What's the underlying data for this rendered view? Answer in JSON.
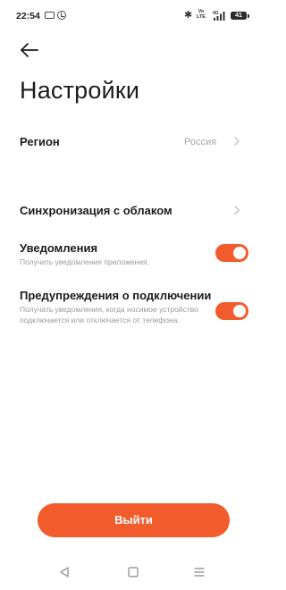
{
  "status_bar": {
    "time": "22:54",
    "bluetooth": "✱",
    "volte_line1": "Vo",
    "volte_line2": "LTE",
    "network": "4G",
    "battery": "41",
    "icons": [
      "mail-icon",
      "alarm-icon",
      "bluetooth-icon",
      "volte-icon",
      "signal-icon",
      "battery-icon"
    ]
  },
  "header": {
    "back_icon": "arrow-left-icon",
    "title": "Настройки"
  },
  "settings": {
    "region": {
      "label": "Регион",
      "value": "Россия"
    },
    "cloud_sync": {
      "label": "Синхронизация с облаком"
    },
    "notifications": {
      "label": "Уведомления",
      "description": "Получать уведомления приложения.",
      "enabled": true
    },
    "connection_alerts": {
      "label": "Предупреждения о подключении",
      "description": "Получать уведомления, когда носимое устройство подключается или отключается от телефона.",
      "enabled": true
    }
  },
  "actions": {
    "logout_label": "Выйти"
  },
  "nav_bar": {
    "items": [
      "back-triangle-icon",
      "home-square-icon",
      "recents-menu-icon"
    ]
  },
  "colors": {
    "accent": "#f25b2c",
    "text": "#1c1c1c",
    "secondary_text": "#9a9a9a",
    "background": "#ffffff"
  }
}
